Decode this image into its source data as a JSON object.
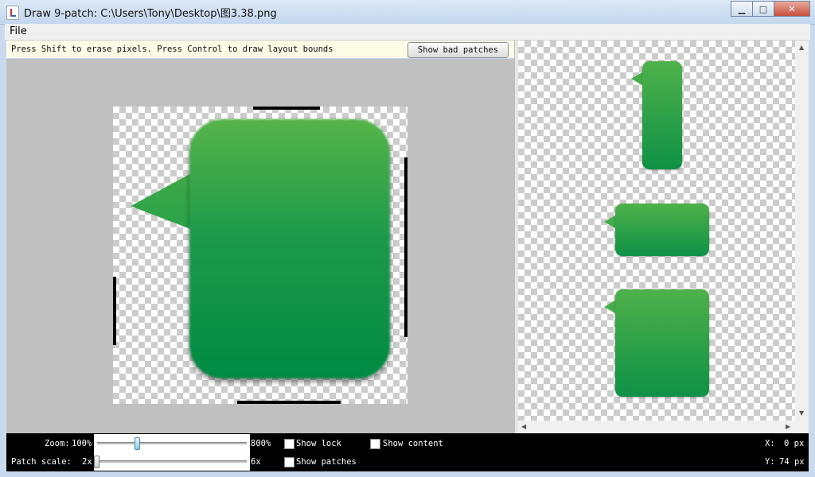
{
  "window": {
    "title": "Draw 9-patch: C:\\Users\\Tony\\Desktop\\图3.38.png",
    "minimize_label": "▁",
    "maximize_label": "□",
    "close_label": "✕"
  },
  "menu": {
    "file_label": "File"
  },
  "hint": {
    "text": "Press Shift to erase pixels. Press Control to draw layout bounds",
    "bad_patches_label": "Show bad patches"
  },
  "controls": {
    "zoom_label": "Zoom:",
    "zoom_min": "100%",
    "zoom_max": "800%",
    "zoom_value_fraction": 0.27,
    "patch_scale_label": "Patch scale:",
    "patch_scale_min": "2x",
    "patch_scale_max": "6x",
    "patch_scale_value_fraction": 0.0,
    "show_lock_label": "Show lock",
    "show_lock_checked": false,
    "show_content_label": "Show content",
    "show_content_checked": false,
    "show_patches_label": "Show patches",
    "show_patches_checked": false,
    "x_label": "X:",
    "x_value": "0 px",
    "y_label": "Y:",
    "y_value": "74 px"
  },
  "colors": {
    "bubble_top": "#56b44a",
    "bubble_bottom": "#008a43",
    "patch_marker": "#000000"
  }
}
